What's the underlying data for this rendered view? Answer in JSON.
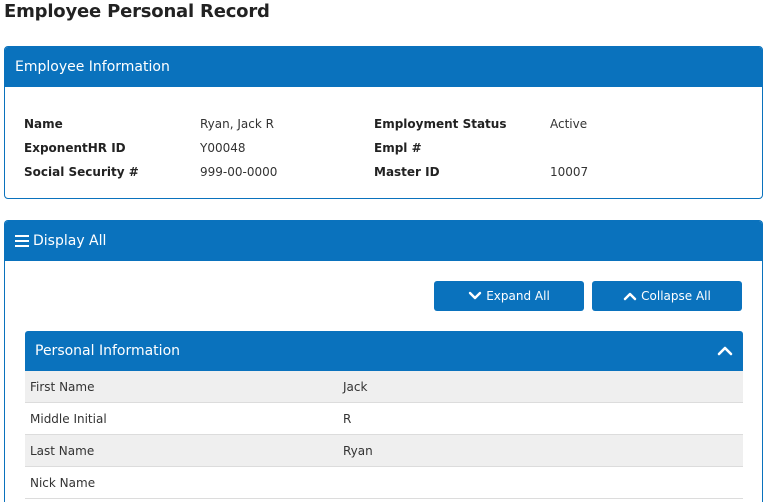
{
  "page": {
    "title": "Employee Personal Record"
  },
  "employee_info": {
    "header": "Employee Information",
    "fields": [
      {
        "label": "Name",
        "value": "Ryan, Jack R"
      },
      {
        "label": "ExponentHR ID",
        "value": "Y00048"
      },
      {
        "label": "Social Security #",
        "value": "999-00-0000"
      },
      {
        "label": "Employment Status",
        "value": "Active"
      },
      {
        "label": "Empl #",
        "value": ""
      },
      {
        "label": "Master ID",
        "value": "10007"
      }
    ]
  },
  "display": {
    "header": "Display All",
    "header_icon": "menu-icon",
    "expand_label": "Expand All",
    "collapse_label": "Collapse All"
  },
  "personal_info": {
    "header": "Personal Information",
    "rows": [
      {
        "label": "First Name",
        "value": "Jack"
      },
      {
        "label": "Middle Initial",
        "value": "R"
      },
      {
        "label": "Last Name",
        "value": "Ryan"
      },
      {
        "label": "Nick Name",
        "value": ""
      }
    ]
  },
  "colors": {
    "primary": "#0a72bd",
    "row_shade": "#efefef"
  }
}
